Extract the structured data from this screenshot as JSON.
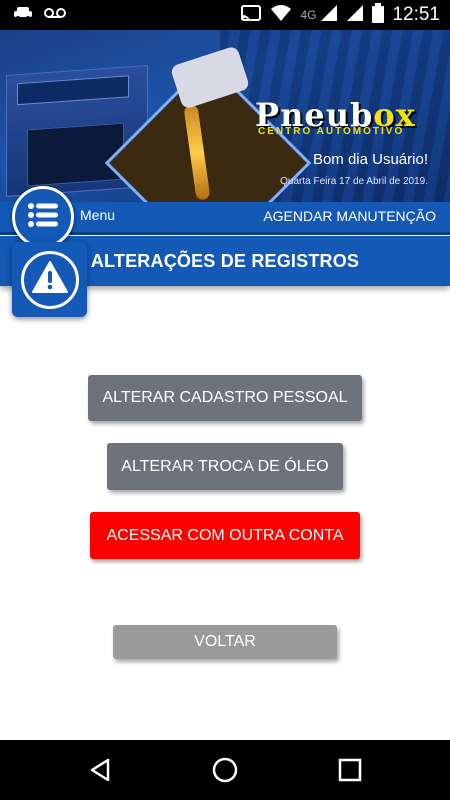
{
  "status_bar": {
    "time": "12:51",
    "network": "4G",
    "icons": [
      "car-notification-icon",
      "voicemail-icon",
      "cast-icon",
      "wifi-icon",
      "signal-icon",
      "battery-icon"
    ]
  },
  "banner": {
    "logo_prefix": "Pneub",
    "logo_accent": "ox",
    "logo_subtitle": "CENTRO AUTOMOTIVO",
    "greeting": "Bom dia Usuário!",
    "date": "Quarta Feira 17 de Abril de 2019."
  },
  "menu_bar": {
    "menu_label": "Menu",
    "schedule_label": "AGENDAR MANUTENÇÃO"
  },
  "page": {
    "title": "ALTERAÇÕES DE REGISTROS"
  },
  "actions": {
    "edit_profile": "ALTERAR CADASTRO PESSOAL",
    "edit_oil_change": "ALTERAR TROCA DE ÓLEO",
    "switch_account": "ACESSAR COM OUTRA CONTA",
    "back": "VOLTAR"
  },
  "colors": {
    "primary": "#1459b6",
    "button_gray": "#6e737b",
    "button_red": "#ff0000",
    "button_back": "#9a9a9a"
  }
}
